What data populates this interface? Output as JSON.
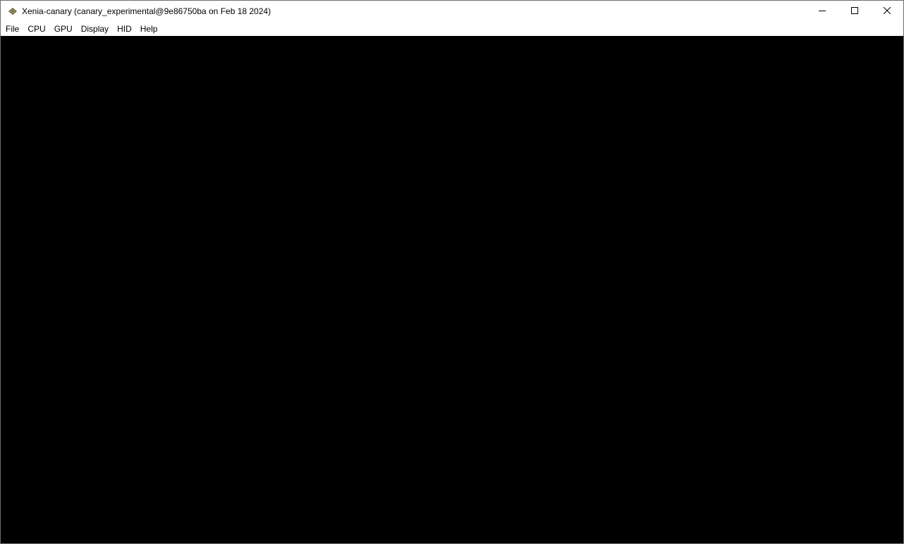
{
  "window": {
    "title": "Xenia-canary (canary_experimental@9e86750ba on Feb 18 2024)",
    "icon": "xenia-app-icon",
    "controls": {
      "minimize": "minimize-icon",
      "maximize": "maximize-icon",
      "close": "close-icon"
    }
  },
  "menubar": {
    "items": [
      {
        "label": "File"
      },
      {
        "label": "CPU"
      },
      {
        "label": "GPU"
      },
      {
        "label": "Display"
      },
      {
        "label": "HID"
      },
      {
        "label": "Help"
      }
    ]
  },
  "content": {
    "background": "#000000"
  }
}
